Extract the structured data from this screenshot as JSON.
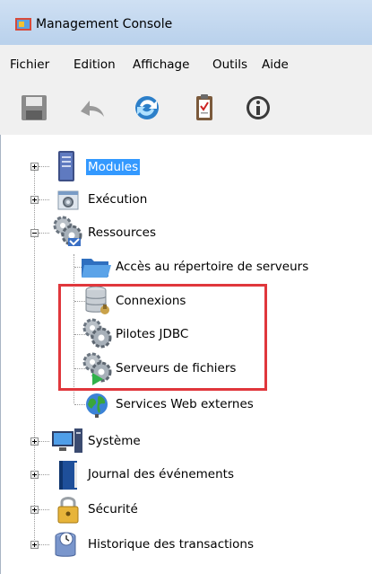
{
  "window": {
    "title": "Management Console"
  },
  "menu": [
    "Fichier",
    "Edition",
    "Affichage",
    "Outils",
    "Aide"
  ],
  "toolbar": [
    {
      "name": "save-icon"
    },
    {
      "name": "undo-icon"
    },
    {
      "name": "refresh-icon"
    },
    {
      "name": "clipboard-icon"
    },
    {
      "name": "info-icon"
    }
  ],
  "tree": {
    "modules": "Modules",
    "execution": "Exécution",
    "ressources": "Ressources",
    "acces": "Accès au répertoire de serveurs",
    "connexions": "Connexions",
    "pilotes": "Pilotes JDBC",
    "serveurs_fichiers": "Serveurs de fichiers",
    "services_web": "Services Web externes",
    "systeme": "Système",
    "journal": "Journal des événements",
    "securite": "Sécurité",
    "historique": "Historique des transactions"
  },
  "colors": {
    "selection": "#3399ff",
    "highlight": "#e0373c"
  }
}
